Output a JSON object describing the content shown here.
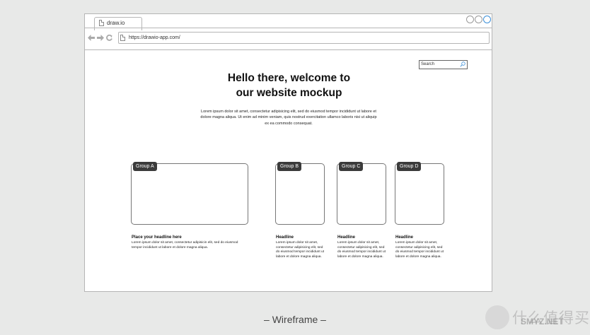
{
  "browser": {
    "tab_title": "draw.io",
    "url": "https://drawio-app.com/"
  },
  "search": {
    "placeholder": "Search"
  },
  "hero": {
    "title_line1": "Hello there, welcome to",
    "title_line2": "our website mockup",
    "text": "Lorem ipsum dolor sit amet, consectetur adipisicing elit, sed do eiusmod tempor incididunt ut labore et dolore magna aliqua. Ut enim ad minim veniam, quis nostrud exercitation ullamco laboris nisi ut aliquip ex ea commodo consequat."
  },
  "groups": [
    {
      "label": "Group A",
      "headline": "Place your headline here",
      "text": "Lorem ipsum dolor sit amet, consectetur adipisicin elit, sed do eiusmod tempor incididunt ut labore et dolore magna aliqua."
    },
    {
      "label": "Group B",
      "headline": "Headline",
      "text": "Lorem ipsum dolor sit amet, consectetur adipisicing elit, sed do eiusmod tempor incididunt ut labore et dolore magna aliqua."
    },
    {
      "label": "Group C",
      "headline": "Headline",
      "text": "Lorem ipsum dolor sit amet, consectetur adipisicing elit, sed do eiusmod tempor incididunt ut labore et dolore magna aliqua."
    },
    {
      "label": "Group D",
      "headline": "Headline",
      "text": "Lorem ipsum dolor sit amet, consectetur adipisicing elit, sed do eiusmod tempor incididunt ut labore et dolore magna aliqua."
    }
  ],
  "caption": "– Wireframe –",
  "watermark": {
    "brand": "什么值得买",
    "sub": "SMYZ.NET"
  },
  "colors": {
    "accent": "#3b8fd8",
    "label_bg": "#3b3b3b"
  }
}
